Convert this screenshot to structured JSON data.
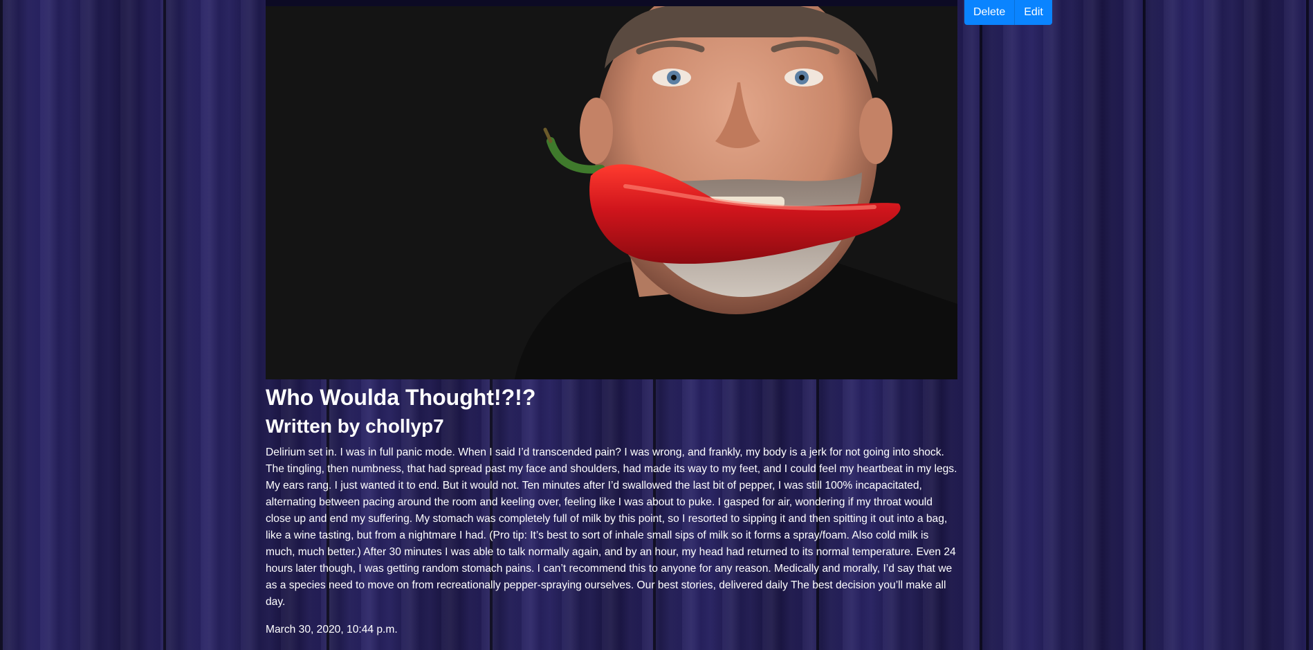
{
  "actions": {
    "delete_label": "Delete",
    "edit_label": "Edit"
  },
  "post": {
    "title": "Who Woulda Thought!?!?",
    "byline": "Written by chollyp7",
    "body": "Delirium set in. I was in full panic mode. When I said I’d transcended pain? I was wrong, and frankly, my body is a jerk for not going into shock. The tingling, then numbness, that had spread past my face and shoulders, had made its way to my feet, and I could feel my heartbeat in my legs. My ears rang. I just wanted it to end. But it would not. Ten minutes after I’d swallowed the last bit of pepper, I was still 100% incapacitated, alternating between pacing around the room and keeling over, feeling like I was about to puke. I gasped for air, wondering if my throat would close up and end my suffering. My stomach was completely full of milk by this point, so I resorted to sipping it and then spitting it out into a bag, like a wine tasting, but from a nightmare I had. (Pro tip: It’s best to sort of inhale small sips of milk so it forms a spray/foam. Also cold milk is much, much better.) After 30 minutes I was able to talk normally again, and by an hour, my head had returned to its normal temperature. Even 24 hours later though, I was getting random stomach pains. I can’t recommend this to anyone for any reason. Medically and morally, I’d say that we as a species need to move on from recreationally pepper-spraying ourselves. Our best stories, delivered daily The best decision you’ll make all day.",
    "timestamp": "March 30, 2020, 10:44 p.m."
  },
  "colors": {
    "button_bg": "#0a84ff",
    "wood_bg": "#1e1a4a",
    "photo_bg": "#141414",
    "pepper": "#d0151c"
  }
}
